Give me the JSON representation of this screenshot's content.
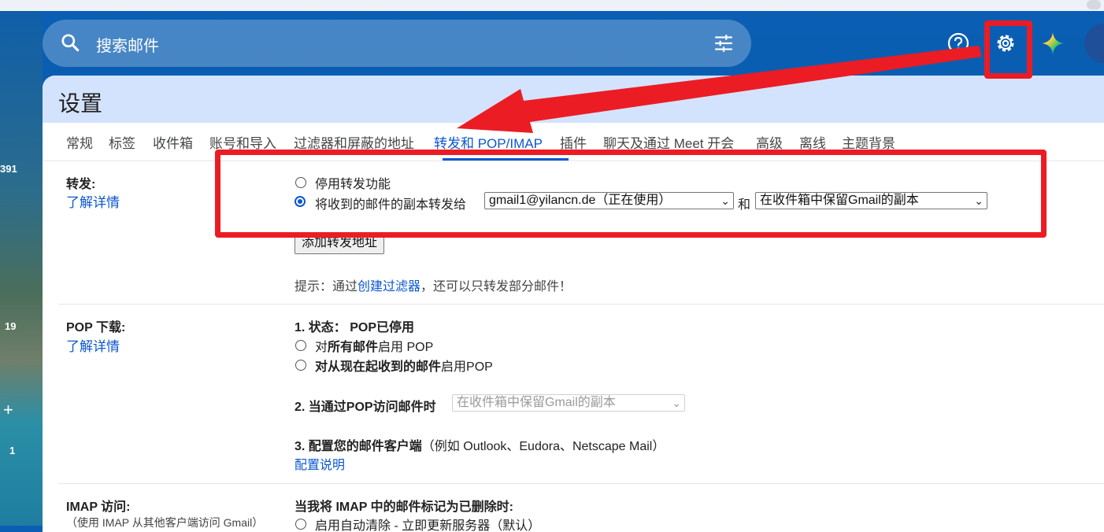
{
  "search": {
    "placeholder": "搜索邮件"
  },
  "sidebar": {
    "nums": [
      "391",
      "19",
      "1"
    ],
    "plus": "+"
  },
  "settings": {
    "title": "设置",
    "tabs": [
      "常规",
      "标签",
      "收件箱",
      "账号和导入",
      "过滤器和屏蔽的地址",
      "转发和 POP/IMAP",
      "插件",
      "聊天及通过 Meet 开会",
      "高级",
      "离线",
      "主题背景"
    ],
    "active_tab": "转发和 POP/IMAP"
  },
  "forwarding": {
    "label": "转发:",
    "learn_more": "了解详情",
    "disable_option": "停用转发功能",
    "forward_option": "将收到的邮件的副本转发给",
    "address_select": "gmail1@yilancn.de（正在使用）",
    "and": "和",
    "action_select": "在收件箱中保留Gmail的副本",
    "add_button": "添加转发地址",
    "tip_prefix": "提示：通过",
    "tip_link": "创建过滤器",
    "tip_suffix": "，还可以只转发部分邮件！"
  },
  "pop": {
    "label": "POP 下载:",
    "learn_more": "了解详情",
    "status_label": "1. 状态：",
    "status_value": "POP已停用",
    "opt1_prefix": "对",
    "opt1_bold": "所有邮件",
    "opt1_suffix": "启用 POP",
    "opt2_bold": "对从现在起收到的邮件",
    "opt2_suffix": "启用POP",
    "step2_label": "2. 当通过POP访问邮件时",
    "step2_select": "在收件箱中保留Gmail的副本",
    "step3_label": "3. 配置您的邮件客户端",
    "step3_suffix": "（例如 Outlook、Eudora、Netscape Mail）",
    "config_link": "配置说明"
  },
  "imap": {
    "label": "IMAP 访问:",
    "sublabel": "（使用 IMAP 从其他客户端访问 Gmail）",
    "delete_heading": "当我将 IMAP 中的邮件标记为已删除时:",
    "opt1": "启用自动清除 - 立即更新服务器（默认）"
  },
  "annotation": {
    "color": "#ec1c24"
  }
}
